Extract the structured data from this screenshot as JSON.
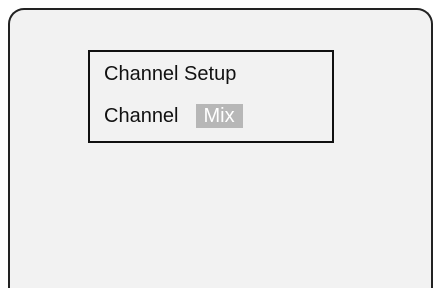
{
  "menu": {
    "title": "Channel Setup",
    "channel": {
      "label": "Channel",
      "value": "Mix"
    }
  }
}
